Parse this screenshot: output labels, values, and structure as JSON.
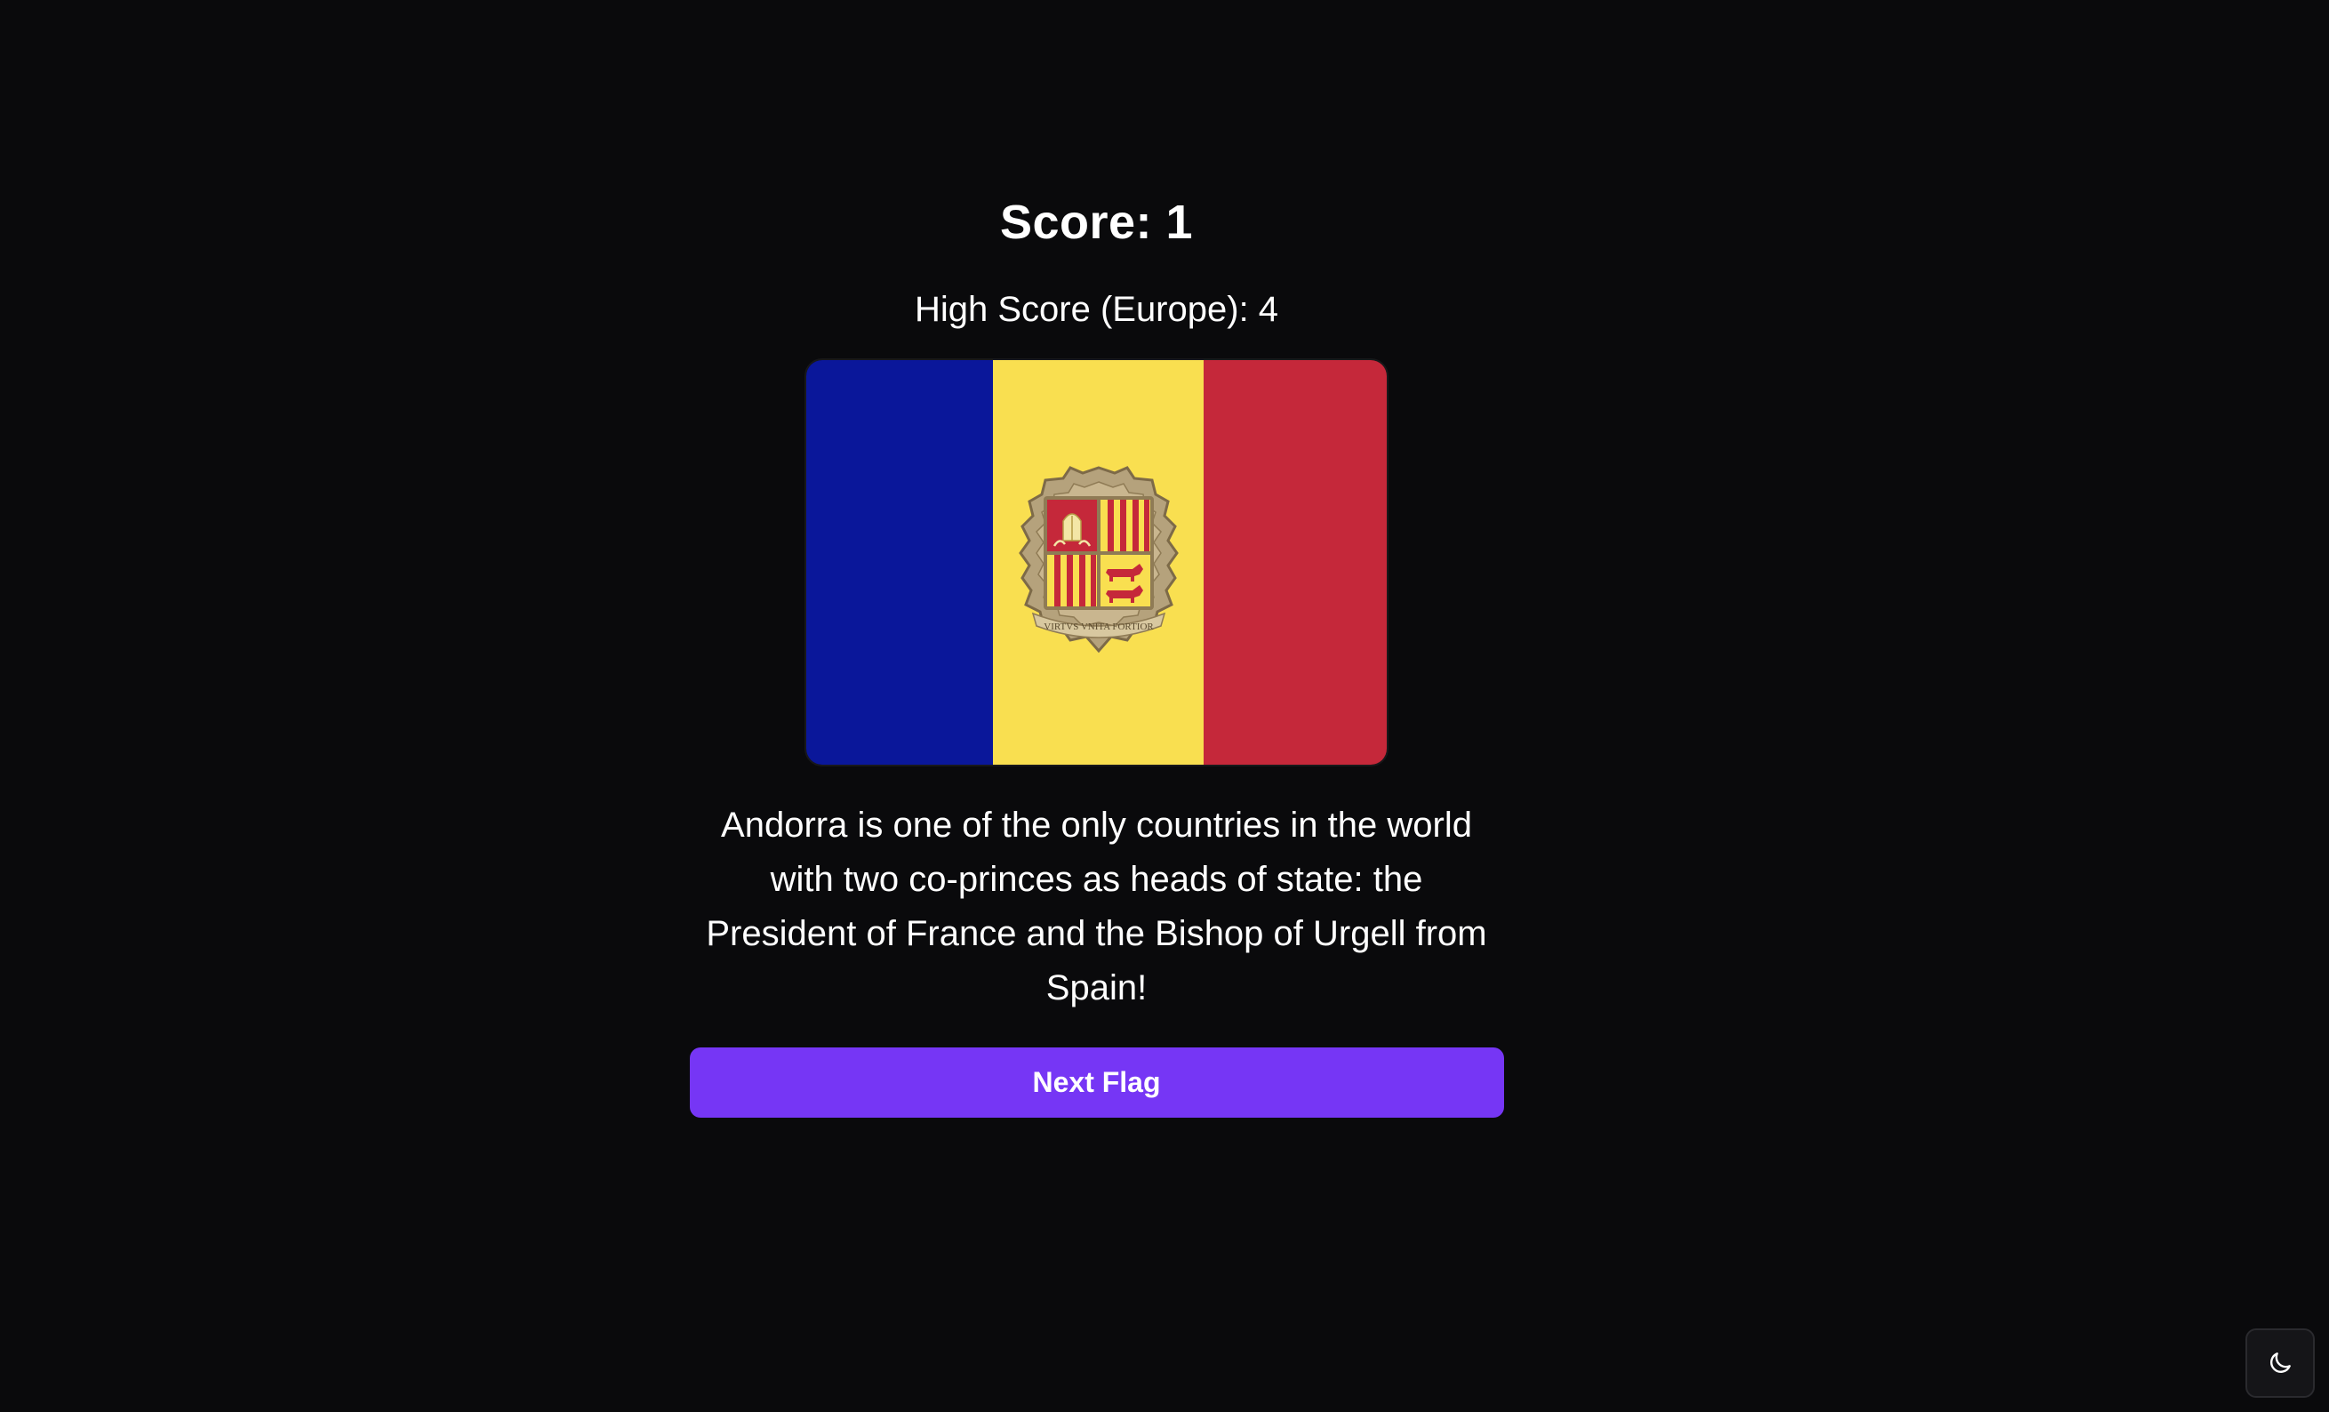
{
  "game": {
    "score_text": "Score: 1",
    "high_score_text": "High Score (Europe): 4",
    "fact": "Andorra is one of the only countries in the world with two co-princes as heads of state: the President of France and the Bishop of Urgell from Spain!",
    "next_button_label": "Next Flag"
  },
  "flag": {
    "alt": "Flag",
    "colors": {
      "blue": "#0a179a",
      "yellow": "#f9df50",
      "red": "#c5283a"
    },
    "coat_of_arms_motto": "VIRTVS VNITA FORTIOR"
  },
  "theme_toggle": {
    "icon": "moon-icon",
    "aria_label": "Toggle theme"
  },
  "colors": {
    "background": "#0a0a0c",
    "accent": "#7636f5"
  }
}
